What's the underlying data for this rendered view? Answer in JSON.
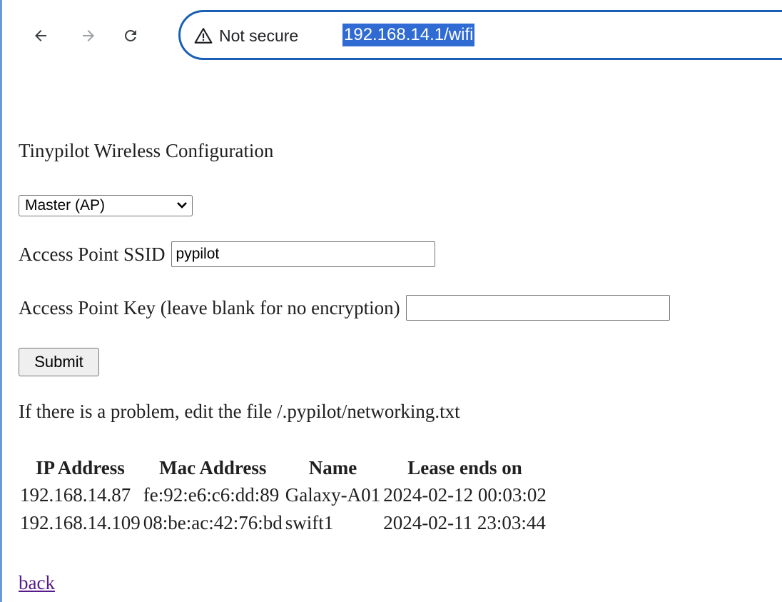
{
  "browser": {
    "security_label": "Not secure",
    "url": "192.168.14.1/wifi"
  },
  "page": {
    "title": "Tinypilot Wireless Configuration",
    "mode_select": {
      "selected": "Master (AP)"
    },
    "ssid": {
      "label": "Access Point SSID",
      "value": "pypilot"
    },
    "key": {
      "label": "Access Point Key (leave blank for no encryption)",
      "value": ""
    },
    "submit_label": "Submit",
    "hint": "If there is a problem, edit the file /.pypilot/networking.txt",
    "leases": {
      "headers": [
        "IP Address",
        "Mac Address",
        "Name",
        "Lease ends on"
      ],
      "rows": [
        [
          "192.168.14.87",
          "fe:92:e6:c6:dd:89",
          "Galaxy-A01",
          "2024-02-12 00:03:02"
        ],
        [
          "192.168.14.109",
          "08:be:ac:42:76:bd",
          "swift1",
          "2024-02-11 23:03:44"
        ]
      ]
    },
    "back_label": "back"
  },
  "icons": {
    "back": "arrow-left-icon",
    "forward": "arrow-right-icon",
    "reload": "reload-icon",
    "warning": "warning-triangle-icon",
    "select_chevron": "chevron-down-icon"
  },
  "colors": {
    "omnibox_border": "#1a5fb4",
    "url_highlight": "#2f6bd3",
    "link_visited": "#551a8b"
  }
}
